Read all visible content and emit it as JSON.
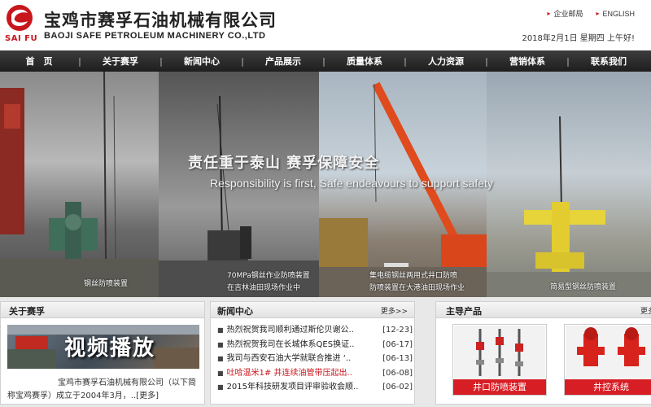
{
  "header": {
    "logo_text": "SAI FU",
    "company_cn": "宝鸡市赛孚石油机械有限公司",
    "company_en": "BAOJI SAFE PETROLEUM MACHINERY CO.,LTD",
    "links": [
      "企业邮局",
      "ENGLISH"
    ],
    "date": "2018年2月1日 星期四 上午好!"
  },
  "nav": [
    "首　页",
    "关于赛孚",
    "新闻中心",
    "产品展示",
    "质量体系",
    "人力资源",
    "营销体系",
    "联系我们"
  ],
  "banner": {
    "slogan_cn": "责任重于泰山  赛孚保障安全",
    "slogan_en": "Responsibility is first, Safe endeavours to support safety",
    "captions": [
      [
        "钢丝防喷装置"
      ],
      [
        "70MPa钢丝作业防喷装置",
        "在吉林油田现场作业中"
      ],
      [
        "集电缆钢丝两用式井口防喷",
        "防喷装置在大港油田现场作业"
      ],
      [
        "简易型钢丝防喷装置"
      ]
    ]
  },
  "about": {
    "title": "关于赛孚",
    "video_label": "视频播放",
    "text": "宝鸡市赛孚石油机械有限公司（以下简称宝鸡赛孚）成立于2004年3月，..[更多]"
  },
  "news": {
    "title": "新闻中心",
    "more": "更多>>",
    "items": [
      {
        "title": "热烈祝贺我司顺利通过斯伦贝谢公..",
        "date": "[12-23]",
        "highlight": false
      },
      {
        "title": "热烈祝贺我司在长城体系QES换证..",
        "date": "[06-17]",
        "highlight": false
      },
      {
        "title": "我司与西安石油大学就联合推进 ‘..",
        "date": "[06-13]",
        "highlight": false
      },
      {
        "title": "吐哈温米1# 井连续油管带压起出..",
        "date": "[06-08]",
        "highlight": true
      },
      {
        "title": "2015年科技研发项目评审验收会顺..",
        "date": "[06-02]",
        "highlight": false
      }
    ]
  },
  "products": {
    "title": "主导产品",
    "more": "更多",
    "items": [
      {
        "label": "井口防喷装置"
      },
      {
        "label": "井控系统"
      }
    ]
  },
  "colors": {
    "brand_red": "#c8161d",
    "nav_bg": "#2a2a2a"
  }
}
